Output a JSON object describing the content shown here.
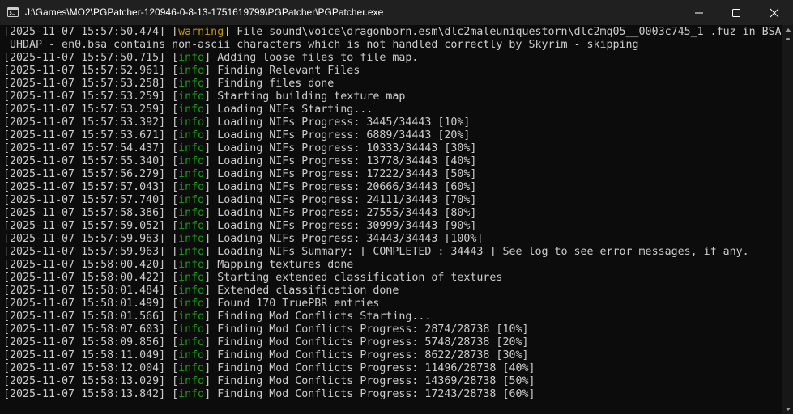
{
  "window": {
    "title": "J:\\Games\\MO2\\PGPatcher-120946-0-8-13-1751619799\\PGPatcher\\PGPatcher.exe",
    "icon": "console-app-icon",
    "buttons": {
      "minimize": "minimize-icon",
      "maximize": "maximize-icon",
      "close": "close-icon"
    }
  },
  "colors": {
    "info": "#13a10e",
    "warning": "#c19c00",
    "text": "#cccccc",
    "background": "#0c0c0c",
    "titlebar": "#202020"
  },
  "console": {
    "lines": [
      {
        "ts": "[2025-11-07 15:57:50.474]",
        "level": "warning",
        "msg": "File sound\\voice\\dragonborn.esm\\dlc2maleuniquestorn\\dlc2mq05__0003c745_1 .fuz in BSA"
      },
      {
        "ts": "",
        "level": "",
        "msg": "UHDAP - en0.bsa contains non-ascii characters which is not handled correctly by Skyrim - skipping"
      },
      {
        "ts": "[2025-11-07 15:57:50.715]",
        "level": "info",
        "msg": "Adding loose files to file map."
      },
      {
        "ts": "[2025-11-07 15:57:52.961]",
        "level": "info",
        "msg": "Finding Relevant Files"
      },
      {
        "ts": "[2025-11-07 15:57:53.258]",
        "level": "info",
        "msg": "Finding files done"
      },
      {
        "ts": "[2025-11-07 15:57:53.259]",
        "level": "info",
        "msg": "Starting building texture map"
      },
      {
        "ts": "[2025-11-07 15:57:53.259]",
        "level": "info",
        "msg": "Loading NIFs Starting..."
      },
      {
        "ts": "[2025-11-07 15:57:53.392]",
        "level": "info",
        "msg": "Loading NIFs Progress: 3445/34443 [10%]"
      },
      {
        "ts": "[2025-11-07 15:57:53.671]",
        "level": "info",
        "msg": "Loading NIFs Progress: 6889/34443 [20%]"
      },
      {
        "ts": "[2025-11-07 15:57:54.437]",
        "level": "info",
        "msg": "Loading NIFs Progress: 10333/34443 [30%]"
      },
      {
        "ts": "[2025-11-07 15:57:55.340]",
        "level": "info",
        "msg": "Loading NIFs Progress: 13778/34443 [40%]"
      },
      {
        "ts": "[2025-11-07 15:57:56.279]",
        "level": "info",
        "msg": "Loading NIFs Progress: 17222/34443 [50%]"
      },
      {
        "ts": "[2025-11-07 15:57:57.043]",
        "level": "info",
        "msg": "Loading NIFs Progress: 20666/34443 [60%]"
      },
      {
        "ts": "[2025-11-07 15:57:57.740]",
        "level": "info",
        "msg": "Loading NIFs Progress: 24111/34443 [70%]"
      },
      {
        "ts": "[2025-11-07 15:57:58.386]",
        "level": "info",
        "msg": "Loading NIFs Progress: 27555/34443 [80%]"
      },
      {
        "ts": "[2025-11-07 15:57:59.052]",
        "level": "info",
        "msg": "Loading NIFs Progress: 30999/34443 [90%]"
      },
      {
        "ts": "[2025-11-07 15:57:59.963]",
        "level": "info",
        "msg": "Loading NIFs Progress: 34443/34443 [100%]"
      },
      {
        "ts": "[2025-11-07 15:57:59.963]",
        "level": "info",
        "msg": "Loading NIFs Summary: [ COMPLETED : 34443 ] See log to see error messages, if any."
      },
      {
        "ts": "[2025-11-07 15:58:00.420]",
        "level": "info",
        "msg": "Mapping textures done"
      },
      {
        "ts": "[2025-11-07 15:58:00.422]",
        "level": "info",
        "msg": "Starting extended classification of textures"
      },
      {
        "ts": "[2025-11-07 15:58:01.484]",
        "level": "info",
        "msg": "Extended classification done"
      },
      {
        "ts": "[2025-11-07 15:58:01.499]",
        "level": "info",
        "msg": "Found 170 TruePBR entries"
      },
      {
        "ts": "[2025-11-07 15:58:01.566]",
        "level": "info",
        "msg": "Finding Mod Conflicts Starting..."
      },
      {
        "ts": "[2025-11-07 15:58:07.603]",
        "level": "info",
        "msg": "Finding Mod Conflicts Progress: 2874/28738 [10%]"
      },
      {
        "ts": "[2025-11-07 15:58:09.856]",
        "level": "info",
        "msg": "Finding Mod Conflicts Progress: 5748/28738 [20%]"
      },
      {
        "ts": "[2025-11-07 15:58:11.049]",
        "level": "info",
        "msg": "Finding Mod Conflicts Progress: 8622/28738 [30%]"
      },
      {
        "ts": "[2025-11-07 15:58:12.004]",
        "level": "info",
        "msg": "Finding Mod Conflicts Progress: 11496/28738 [40%]"
      },
      {
        "ts": "[2025-11-07 15:58:13.029]",
        "level": "info",
        "msg": "Finding Mod Conflicts Progress: 14369/28738 [50%]"
      },
      {
        "ts": "[2025-11-07 15:58:13.842]",
        "level": "info",
        "msg": "Finding Mod Conflicts Progress: 17243/28738 [60%]"
      }
    ]
  },
  "scrollbar": {
    "up": "chevron-up-icon",
    "down": "chevron-down-icon"
  }
}
